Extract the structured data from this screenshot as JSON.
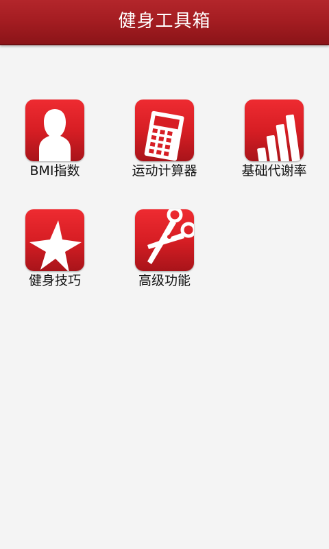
{
  "header": {
    "title": "健身工具箱"
  },
  "items": [
    {
      "label": "BMI指数",
      "icon": "person-silhouette-icon"
    },
    {
      "label": "运动计算器",
      "icon": "calculator-icon"
    },
    {
      "label": "基础代谢率",
      "icon": "bar-chart-icon"
    },
    {
      "label": "健身技巧",
      "icon": "star-icon"
    },
    {
      "label": "高级功能",
      "icon": "scissors-icon"
    }
  ],
  "colors": {
    "header_bg": "#a51d22",
    "tile_bg": "#d71e24",
    "page_bg": "#f4f4f4"
  }
}
